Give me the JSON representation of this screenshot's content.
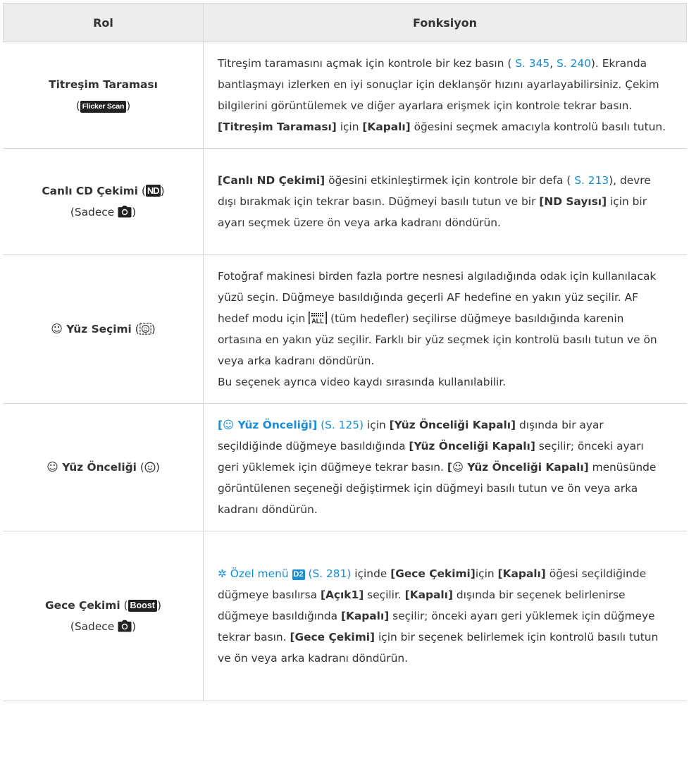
{
  "table": {
    "header": {
      "role": "Rol",
      "function": "Fonksiyon"
    },
    "rows": [
      {
        "role": {
          "name": "Titreşim Taraması",
          "open": "(",
          "badge": "Flicker Scan",
          "close": ")"
        },
        "desc": {
          "t1": "Titreşim taramasını açmak için kontrole bir kez basın ( ",
          "link1": "S. 345",
          "t2": ", ",
          "link2": "S. 240",
          "t3": "). Ekranda bantlaşmayı izlerken en iyi sonuçlar için deklanşör hızını ayarlayabilirsiniz. Çekim bilgilerini görüntülemek ve diğer ayarlara erişmek için kontrole tekrar basın. ",
          "b1": "[Titreşim Taraması]",
          "t4": " için ",
          "b2": "[Kapalı]",
          "t5": " öğesini seçmek amacıyla kontrolü basılı tutun."
        }
      },
      {
        "role": {
          "name": "Canlı CD Çekimi",
          "open": " (",
          "badge": "ND",
          "close": ")",
          "line2_open": "(Sadece ",
          "line2_close": ")"
        },
        "desc": {
          "b1": "[Canlı ND Çekimi]",
          "t1": " öğesini etkinleştirmek için kontrole bir defa (",
          "link1": " S. 213",
          "t2": "), devre dışı bırakmak için tekrar basın. Düğmeyi basılı tutun ve bir ",
          "b2": "[ND Sayısı]",
          "t3": " için bir ayarı seçmek üzere ön veya arka kadranı döndürün."
        }
      },
      {
        "role": {
          "symbol": "☺",
          "name": "Yüz Seçimi",
          "open": " (",
          "close": ")"
        },
        "desc": {
          "t1": "Fotoğraf makinesi birden fazla portre nesnesi algıladığında odak için kullanılacak yüzü seçin. Düğmeye basıldığında geçerli AF hedefine en yakın yüz seçilir. AF hedef modu için ",
          "t2": " (tüm hedefler) seçilirse düğmeye basıldığında karenin ortasına en yakın yüz seçilir. Farklı bir yüz seçmek için kontrolü basılı tutun ve ön veya arka kadranı döndürün.",
          "t3": "Bu seçenek ayrıca video kaydı sırasında kullanılabilir."
        }
      },
      {
        "role": {
          "symbol": "☺",
          "name": "Yüz Önceliği",
          "open": " (",
          "close": ")"
        },
        "desc": {
          "link1_open": "[",
          "link1_sym": "☺",
          "link1_text": " Yüz Önceliği]",
          "link1_page": " (S. 125)",
          "t1": " için ",
          "b1": "[Yüz Önceliği Kapalı]",
          "t2": " dışında bir ayar seçildiğinde düğmeye basıldığında ",
          "b2": "[Yüz Önceliği Kapalı]",
          "t3": " seçilir; önceki ayarı geri yüklemek için düğmeye tekrar basın. ",
          "b3_open": "[",
          "b3_sym": "☺",
          "b3_text": " Yüz Önceliği Kapalı]",
          "t4": " menüsünde görüntülenen seçeneği değiştirmek için düğmeyi basılı tutun ve ön veya arka kadranı döndürün."
        }
      },
      {
        "role": {
          "name": "Gece Çekimi",
          "open": " (",
          "badge": "Boost",
          "close": ")",
          "line2_open": "(Sadece ",
          "line2_close": ")"
        },
        "desc": {
          "gear": "✲",
          "link1": " Özel menü ",
          "d2": "D2",
          "link1_page": " (S. 281)",
          "t1": " içinde ",
          "b1": "[Gece Çekimi]",
          "t2": "için ",
          "b2": "[Kapalı]",
          "t3": " öğesi seçildiğinde düğmeye basılırsa ",
          "b3": "[Açık1]",
          "t4": " seçilir. ",
          "b4": "[Kapalı]",
          "t5": " dışında bir seçenek belirlenirse düğmeye basıldığında ",
          "b5": "[Kapalı]",
          "t6": " seçilir; önceki ayarı geri yüklemek için düğmeye tekrar basın. ",
          "b6": "[Gece Çekimi]",
          "t7": " için bir seçenek belirlemek için kontrolü basılı tutun ve ön veya arka kadranı döndürün."
        }
      }
    ]
  },
  "icons": {
    "camera": "camera-icon",
    "face": "face-icon",
    "face_frame": "face-select-icon",
    "all_targets": "all-targets-af-icon",
    "gear": "custom-menu-gear-icon"
  },
  "colors": {
    "link": "#1a8cd8",
    "header_bg": "#ededed",
    "border": "#d6d6d6",
    "text": "#333333"
  }
}
